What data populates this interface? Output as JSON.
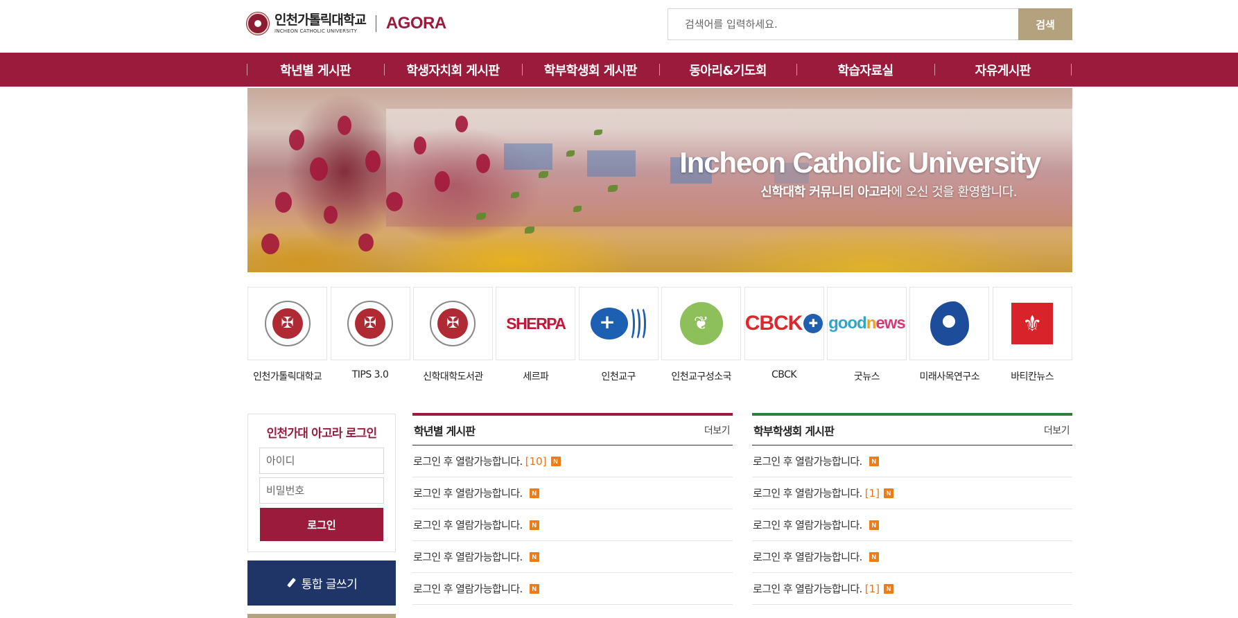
{
  "header": {
    "logo_ko": "인천가톨릭대학교",
    "logo_en": "INCHEON CATHOLIC UNIVERSITY",
    "brand": "AGORA",
    "search_placeholder": "검색어를 입력하세요.",
    "search_button": "검색"
  },
  "nav": {
    "items": [
      {
        "label": "학년별 게시판"
      },
      {
        "label": "학생자치회 게시판"
      },
      {
        "label": "학부학생회 게시판"
      },
      {
        "label": "동아리&기도회"
      },
      {
        "label": "학습자료실"
      },
      {
        "label": "자유게시판"
      }
    ]
  },
  "banner": {
    "title": "Incheon Catholic University",
    "subtitle_bold": "신학대학 커뮤니티 아고라",
    "subtitle_rest": "에 오신 것을 환영합니다."
  },
  "quick_links": [
    {
      "label": "인천가톨릭대학교",
      "icon": "university-seal-icon"
    },
    {
      "label": "TIPS 3.0",
      "icon": "university-seal-icon"
    },
    {
      "label": "신학대학도서관",
      "icon": "university-seal-icon"
    },
    {
      "label": "세르파",
      "icon": "sherpa-logo",
      "logo_text": "SHERPA"
    },
    {
      "label": "인천교구",
      "icon": "diocese-logo"
    },
    {
      "label": "인천교구성소국",
      "icon": "vocation-office-logo"
    },
    {
      "label": "CBCK",
      "icon": "cbck-logo",
      "logo_text": "CBCK"
    },
    {
      "label": "굿뉴스",
      "icon": "goodnews-logo",
      "logo_parts": [
        "good",
        "n",
        "ews"
      ]
    },
    {
      "label": "미래사목연구소",
      "icon": "mirae-logo"
    },
    {
      "label": "바티칸뉴스",
      "icon": "vatican-logo"
    }
  ],
  "login": {
    "title": "인천가대 아고라 로그인",
    "id_placeholder": "아이디",
    "pw_placeholder": "비밀번호",
    "button": "로그인"
  },
  "write_button": "통합 글쓰기",
  "boards": [
    {
      "title": "학년별 게시판",
      "more": "더보기",
      "accent": "#9b1b3c",
      "new_badge": "N",
      "rows": [
        {
          "text": "로그인 후 열람가능합니다.",
          "count": "[10]"
        },
        {
          "text": "로그인 후 열람가능합니다.",
          "count": ""
        },
        {
          "text": "로그인 후 열람가능합니다.",
          "count": ""
        },
        {
          "text": "로그인 후 열람가능합니다.",
          "count": ""
        },
        {
          "text": "로그인 후 열람가능합니다.",
          "count": ""
        }
      ]
    },
    {
      "title": "학부학생회 게시판",
      "more": "더보기",
      "accent": "#2e7d3a",
      "new_badge": "N",
      "rows": [
        {
          "text": "로그인 후 열람가능합니다.",
          "count": ""
        },
        {
          "text": "로그인 후 열람가능합니다.",
          "count": "[1]"
        },
        {
          "text": "로그인 후 열람가능합니다.",
          "count": ""
        },
        {
          "text": "로그인 후 열람가능합니다.",
          "count": ""
        },
        {
          "text": "로그인 후 열람가능합니다.",
          "count": "[1]"
        }
      ]
    }
  ],
  "colors": {
    "brand": "#9b1b3c",
    "search_button": "#b4a17e",
    "write_button": "#1f3567",
    "new_badge": "#f07b15",
    "count_text": "#e8741c"
  }
}
